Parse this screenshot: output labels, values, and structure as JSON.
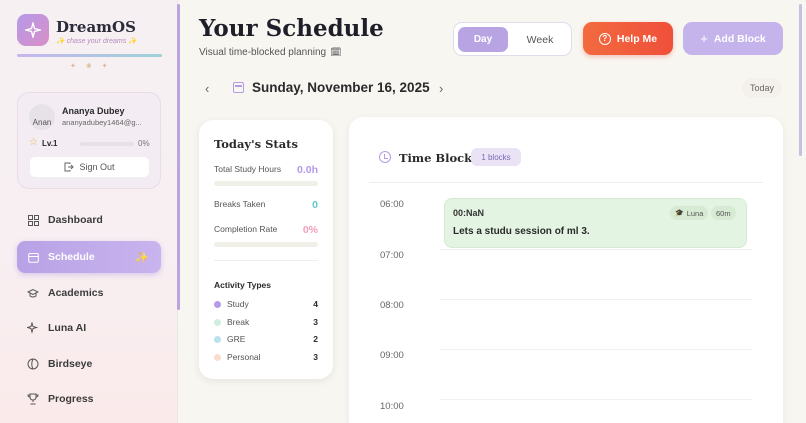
{
  "app": {
    "name": "DreamOS",
    "tagline": "✨ chase your dreams ✨",
    "sparkles": "✦ ❀ ✦"
  },
  "user": {
    "name": "Ananya Dubey",
    "email": "ananyadubey1464@g...",
    "avatar_alt": "Anan",
    "level": "Lv.1",
    "level_progress": 0,
    "level_pct_text": "0%",
    "signout_label": "Sign Out"
  },
  "nav": {
    "items": [
      {
        "label": "Dashboard",
        "icon": "grid-icon"
      },
      {
        "label": "Schedule",
        "icon": "calendar-icon",
        "active": true,
        "badge": "✨"
      },
      {
        "label": "Academics",
        "icon": "graduation-cap-icon"
      },
      {
        "label": "Luna AI",
        "icon": "sparkles-icon"
      },
      {
        "label": "Birdseye",
        "icon": "compass-icon"
      },
      {
        "label": "Progress",
        "icon": "trophy-icon"
      }
    ]
  },
  "header": {
    "title": "Your Schedule",
    "subtitle": "Visual time-blocked planning",
    "subtitle_icon": "🗓",
    "view_day": "Day",
    "view_week": "Week",
    "help_label": "Help Me",
    "help_icon": "?",
    "add_label": "Add Block",
    "add_icon": "+"
  },
  "date_nav": {
    "prev": "‹",
    "next": "›",
    "date": "Sunday, November 16, 2025",
    "today_label": "Today"
  },
  "stats": {
    "title": "Today's Stats",
    "items": [
      {
        "label": "Total Study Hours",
        "value": "0.0h",
        "color": "#b59ae8",
        "progress": 0
      },
      {
        "label": "Breaks Taken",
        "value": "0",
        "color": "#5dc9cf"
      },
      {
        "label": "Completion Rate",
        "value": "0%",
        "color": "#f2a0ba",
        "progress": 0
      }
    ],
    "types_title": "Activity Types",
    "types": [
      {
        "name": "Study",
        "count": "4",
        "color": "#b59ae8"
      },
      {
        "name": "Break",
        "count": "3",
        "color": "#cfeee0"
      },
      {
        "name": "GRE",
        "count": "2",
        "color": "#b9e2ec"
      },
      {
        "name": "Personal",
        "count": "3",
        "color": "#fadccf"
      }
    ]
  },
  "time_blocks": {
    "title": "Time Blocks",
    "badge": "1 blocks",
    "hours": [
      "06:00",
      "07:00",
      "08:00",
      "09:00",
      "10:00"
    ],
    "event": {
      "time": "00:NaN",
      "title": "Lets a studu session of ml 3.",
      "tag": "Luna",
      "tag_icon": "🎓",
      "duration": "60m"
    }
  },
  "colors": {
    "accent": "#b59ae8",
    "help": "#f05a3c",
    "add": "#c5b4ec",
    "event_bg": "#e3f4e2"
  }
}
